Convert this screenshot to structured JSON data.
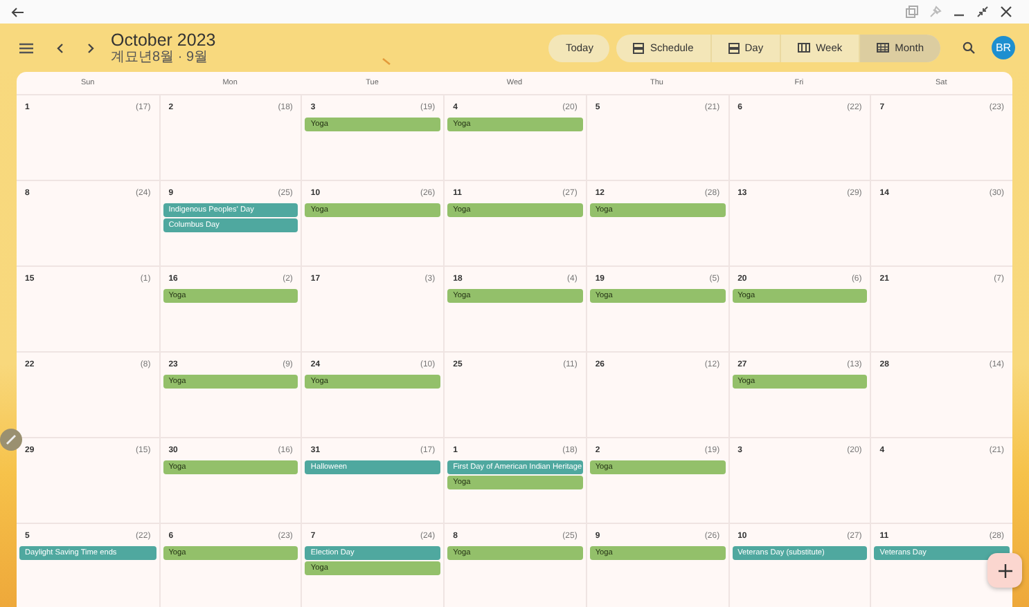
{
  "title": "October 2023",
  "subtitle": "계묘년8월 · 9월",
  "today_button": "Today",
  "views": [
    {
      "label": "Schedule",
      "selected": false
    },
    {
      "label": "Day",
      "selected": false
    },
    {
      "label": "Week",
      "selected": false
    },
    {
      "label": "Month",
      "selected": true
    }
  ],
  "avatar": "BR",
  "weekdays": [
    "Sun",
    "Mon",
    "Tue",
    "Wed",
    "Thu",
    "Fri",
    "Sat"
  ],
  "weeks": [
    {
      "days": [
        {
          "date": "1",
          "lunar": "(17)"
        },
        {
          "date": "2",
          "lunar": "(18)"
        },
        {
          "date": "3",
          "lunar": "(19)",
          "events": [
            {
              "title": "Yoga",
              "color": "#93c06a"
            }
          ]
        },
        {
          "date": "4",
          "lunar": "(20)",
          "events": [
            {
              "title": "Yoga",
              "color": "#93c06a"
            }
          ]
        },
        {
          "date": "5",
          "lunar": "(21)"
        },
        {
          "date": "6",
          "lunar": "(22)"
        },
        {
          "date": "7",
          "lunar": "(23)"
        }
      ]
    },
    {
      "days": [
        {
          "date": "8",
          "lunar": "(24)"
        },
        {
          "date": "9",
          "lunar": "(25)",
          "events": [
            {
              "title": "Indigenous Peoples' Day",
              "color": "#4fa89f"
            },
            {
              "title": "Columbus Day",
              "color": "#4fa89f"
            }
          ]
        },
        {
          "date": "10",
          "lunar": "(26)",
          "events": [
            {
              "title": "Yoga",
              "color": "#93c06a"
            }
          ]
        },
        {
          "date": "11",
          "lunar": "(27)",
          "events": [
            {
              "title": "Yoga",
              "color": "#93c06a"
            }
          ]
        },
        {
          "date": "12",
          "lunar": "(28)",
          "events": [
            {
              "title": "Yoga",
              "color": "#93c06a"
            }
          ]
        },
        {
          "date": "13",
          "lunar": "(29)"
        },
        {
          "date": "14",
          "lunar": "(30)"
        }
      ]
    },
    {
      "days": [
        {
          "date": "15",
          "lunar": "(1)"
        },
        {
          "date": "16",
          "lunar": "(2)",
          "events": [
            {
              "title": "Yoga",
              "color": "#93c06a"
            }
          ]
        },
        {
          "date": "17",
          "lunar": "(3)"
        },
        {
          "date": "18",
          "lunar": "(4)",
          "events": [
            {
              "title": "Yoga",
              "color": "#93c06a"
            }
          ]
        },
        {
          "date": "19",
          "lunar": "(5)",
          "events": [
            {
              "title": "Yoga",
              "color": "#93c06a"
            }
          ]
        },
        {
          "date": "20",
          "lunar": "(6)",
          "events": [
            {
              "title": "Yoga",
              "color": "#93c06a"
            }
          ]
        },
        {
          "date": "21",
          "lunar": "(7)"
        }
      ]
    },
    {
      "days": [
        {
          "date": "22",
          "lunar": "(8)"
        },
        {
          "date": "23",
          "lunar": "(9)",
          "events": [
            {
              "title": "Yoga",
              "color": "#93c06a"
            }
          ]
        },
        {
          "date": "24",
          "lunar": "(10)",
          "events": [
            {
              "title": "Yoga",
              "color": "#93c06a"
            }
          ]
        },
        {
          "date": "25",
          "lunar": "(11)"
        },
        {
          "date": "26",
          "lunar": "(12)"
        },
        {
          "date": "27",
          "lunar": "(13)",
          "events": [
            {
              "title": "Yoga",
              "color": "#93c06a"
            }
          ]
        },
        {
          "date": "28",
          "lunar": "(14)"
        }
      ]
    },
    {
      "days": [
        {
          "date": "29",
          "lunar": "(15)"
        },
        {
          "date": "30",
          "lunar": "(16)",
          "events": [
            {
              "title": "Yoga",
              "color": "#93c06a"
            }
          ]
        },
        {
          "date": "31",
          "lunar": "(17)",
          "events": [
            {
              "title": "Halloween",
              "color": "#4fa89f"
            }
          ]
        },
        {
          "date": "1",
          "lunar": "(18)",
          "events": [
            {
              "title": "First Day of American Indian Heritage",
              "color": "#4fa89f"
            },
            {
              "title": "Yoga",
              "color": "#93c06a"
            }
          ]
        },
        {
          "date": "2",
          "lunar": "(19)",
          "events": [
            {
              "title": "Yoga",
              "color": "#93c06a"
            }
          ]
        },
        {
          "date": "3",
          "lunar": "(20)"
        },
        {
          "date": "4",
          "lunar": "(21)"
        }
      ]
    },
    {
      "days": [
        {
          "date": "5",
          "lunar": "(22)",
          "events": [
            {
              "title": "Daylight Saving Time ends",
              "color": "#4fa89f"
            }
          ]
        },
        {
          "date": "6",
          "lunar": "(23)",
          "events": [
            {
              "title": "Yoga",
              "color": "#93c06a"
            }
          ]
        },
        {
          "date": "7",
          "lunar": "(24)",
          "events": [
            {
              "title": "Election Day",
              "color": "#4fa89f"
            },
            {
              "title": "Yoga",
              "color": "#93c06a"
            }
          ]
        },
        {
          "date": "8",
          "lunar": "(25)",
          "events": [
            {
              "title": "Yoga",
              "color": "#93c06a"
            }
          ]
        },
        {
          "date": "9",
          "lunar": "(26)",
          "events": [
            {
              "title": "Yoga",
              "color": "#93c06a"
            }
          ]
        },
        {
          "date": "10",
          "lunar": "(27)",
          "events": [
            {
              "title": "Veterans Day (substitute)",
              "color": "#4fa89f"
            }
          ]
        },
        {
          "date": "11",
          "lunar": "(28)",
          "events": [
            {
              "title": "Veterans Day",
              "color": "#4fa89f"
            }
          ]
        }
      ]
    }
  ]
}
